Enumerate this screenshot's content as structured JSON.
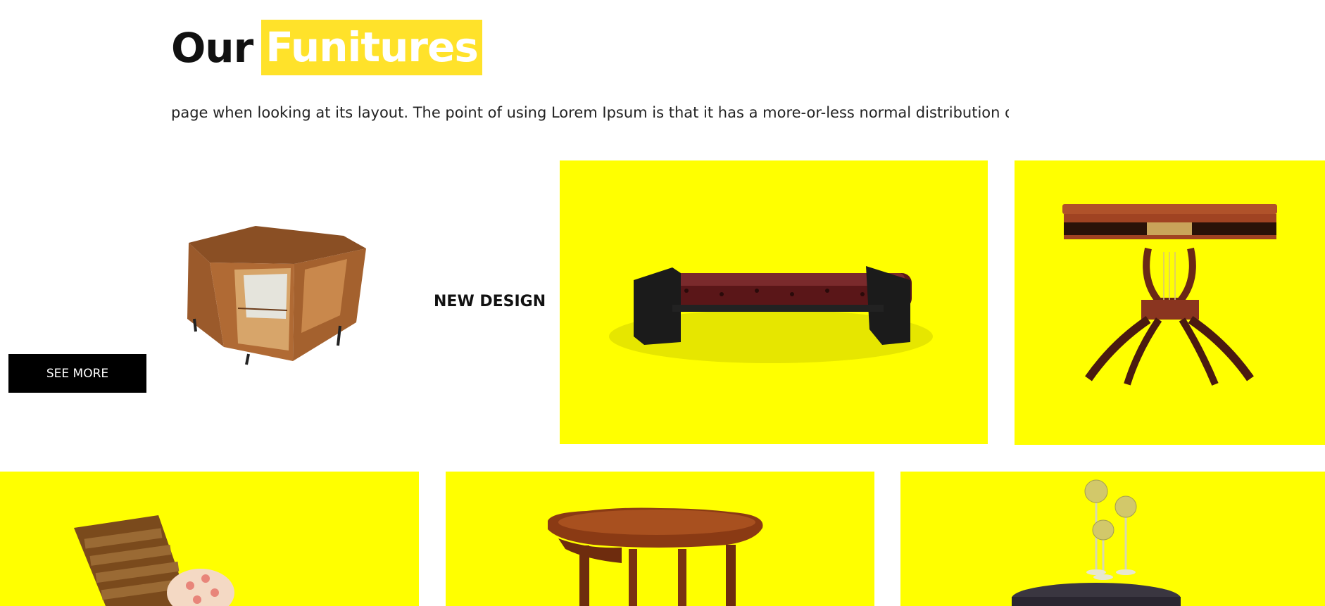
{
  "section": {
    "title_plain": "Our",
    "title_highlight": "Funitures",
    "intro_text": "page when looking at its layout. The point of using Lorem Ipsum is that it has a more-or-less normal distribution o"
  },
  "featured": {
    "button_label": "SEE MORE",
    "tag_label": "NEW DESIGN"
  },
  "colors": {
    "card_bg": "#ffff00",
    "highlight_bg": "#ffe22a",
    "button_bg": "#000000"
  },
  "products": [
    {
      "icon": "bench-image"
    },
    {
      "icon": "lyre-table-image"
    },
    {
      "icon": "lounge-chair-image"
    },
    {
      "icon": "round-wooden-table-image"
    },
    {
      "icon": "wine-table-image"
    }
  ]
}
